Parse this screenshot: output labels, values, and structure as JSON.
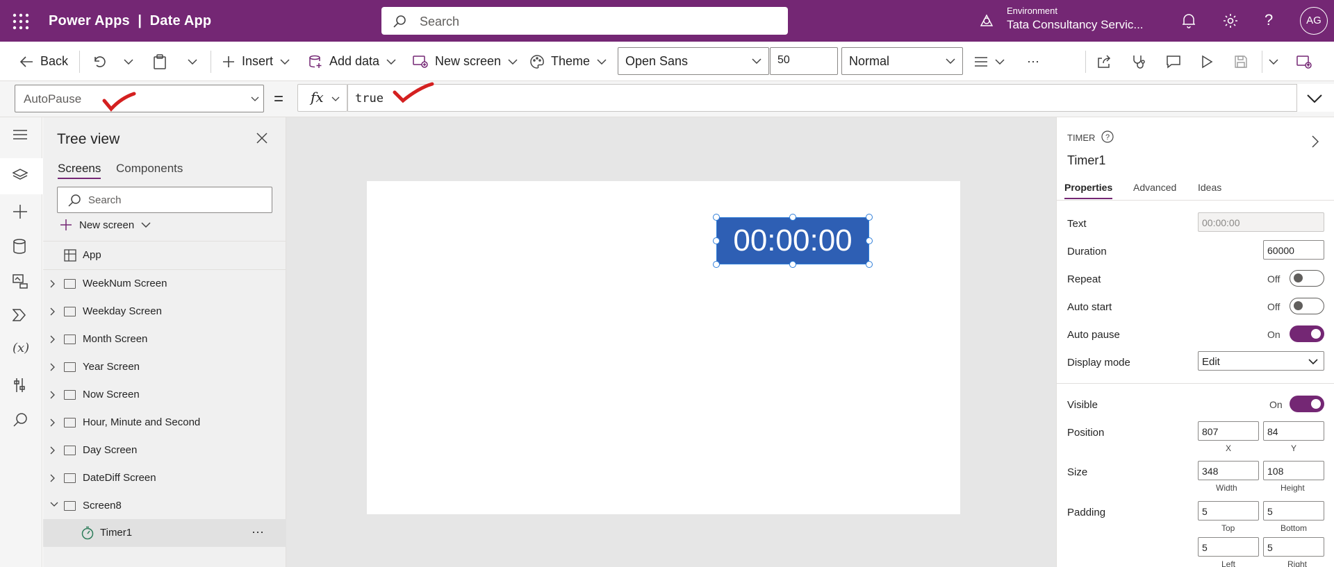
{
  "topbar": {
    "app_title": "Power Apps  |  Date App",
    "search_placeholder": "Search",
    "env_label": "Environment",
    "env_name": "Tata Consultancy Servic...",
    "avatar_initials": "AG",
    "bg_color": "#742774"
  },
  "commandbar": {
    "back": "Back",
    "insert": "Insert",
    "add_data": "Add data",
    "new_screen": "New screen",
    "theme": "Theme",
    "font_family": "Open Sans",
    "font_size": "50",
    "font_weight": "Normal",
    "more": "···"
  },
  "formulabar": {
    "property": "AutoPause",
    "equals": "=",
    "fx": "fx",
    "formula": "true"
  },
  "treeview": {
    "title": "Tree view",
    "tabs": [
      "Screens",
      "Components"
    ],
    "search_placeholder": "Search",
    "new_screen": "New screen",
    "app_item": "App",
    "items": [
      {
        "label": "WeekNum Screen"
      },
      {
        "label": "Weekday Screen"
      },
      {
        "label": "Month Screen"
      },
      {
        "label": "Year Screen"
      },
      {
        "label": "Now Screen"
      },
      {
        "label": "Hour, Minute and Second"
      },
      {
        "label": "Day Screen"
      },
      {
        "label": "DateDiff Screen"
      },
      {
        "label": "Screen8"
      }
    ],
    "child_item": "Timer1",
    "child_more": "···"
  },
  "canvas": {
    "timer_text": "00:00:00"
  },
  "properties": {
    "control_type": "TIMER",
    "control_name": "Timer1",
    "tabs": [
      "Properties",
      "Advanced",
      "Ideas"
    ],
    "text_label": "Text",
    "text_value": "00:00:00",
    "duration_label": "Duration",
    "duration_value": "60000",
    "repeat_label": "Repeat",
    "repeat_state": "Off",
    "autostart_label": "Auto start",
    "autostart_state": "Off",
    "autopause_label": "Auto pause",
    "autopause_state": "On",
    "displaymode_label": "Display mode",
    "displaymode_value": "Edit",
    "visible_label": "Visible",
    "visible_state": "On",
    "position_label": "Position",
    "position_x": "807",
    "position_y": "84",
    "x_label": "X",
    "y_label": "Y",
    "size_label": "Size",
    "size_width": "348",
    "size_height": "108",
    "width_label": "Width",
    "height_label": "Height",
    "padding_label": "Padding",
    "padding_top": "5",
    "padding_bottom": "5",
    "padding_left": "5",
    "padding_right": "5",
    "top_label": "Top",
    "bottom_label": "Bottom",
    "left_label": "Left",
    "right_label": "Right"
  },
  "colors": {
    "accent": "#742774",
    "timer_fill": "#2e5fb4",
    "annotation_red": "#d42020"
  }
}
